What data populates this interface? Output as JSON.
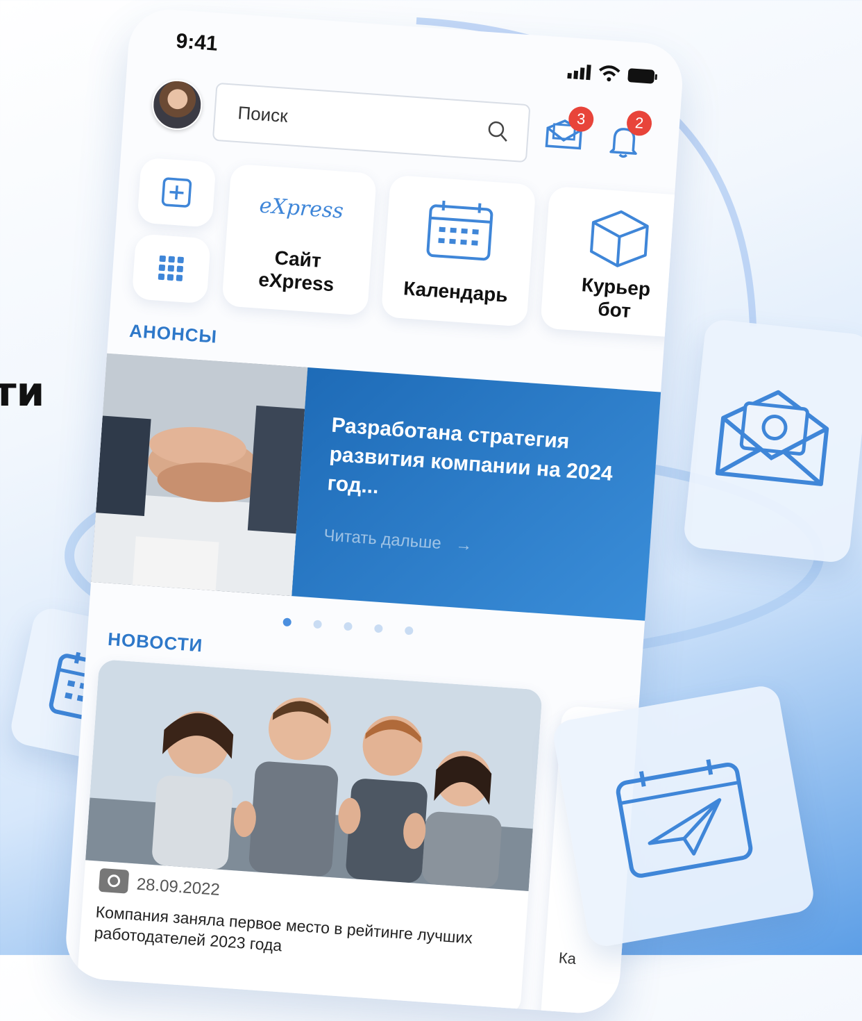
{
  "side_heading": "ти",
  "status": {
    "time": "9:41"
  },
  "search": {
    "placeholder": "Поиск"
  },
  "notifications": {
    "mail_count": "3",
    "bell_count": "2"
  },
  "quick_tiles": [
    {
      "logo": "eXpress",
      "label_line1": "Сайт",
      "label_line2": "eXpress"
    },
    {
      "label": "Календарь"
    },
    {
      "label_line1": "Курьер",
      "label_line2": "бот"
    }
  ],
  "announcements": {
    "title": "АНОНСЫ",
    "banner_title": "Разработана стратегия развития компании на 2024 год...",
    "read_more": "Читать дальше",
    "arrow": "→"
  },
  "news": {
    "title": "НОВОСТИ",
    "items": [
      {
        "date": "28.09.2022",
        "text": "Компания заняла первое место в рейтинге лучших работодателей 2023 года"
      },
      {
        "text": "Ка"
      }
    ]
  },
  "colors": {
    "accent": "#2e78c9",
    "badge": "#e8443a",
    "banner": "#2a7cc9"
  },
  "icons": [
    "plus-icon",
    "grid-icon",
    "calendar-icon",
    "box-icon",
    "mail-icon",
    "bell-icon",
    "search-icon",
    "camera-icon",
    "paper-plane-icon"
  ]
}
